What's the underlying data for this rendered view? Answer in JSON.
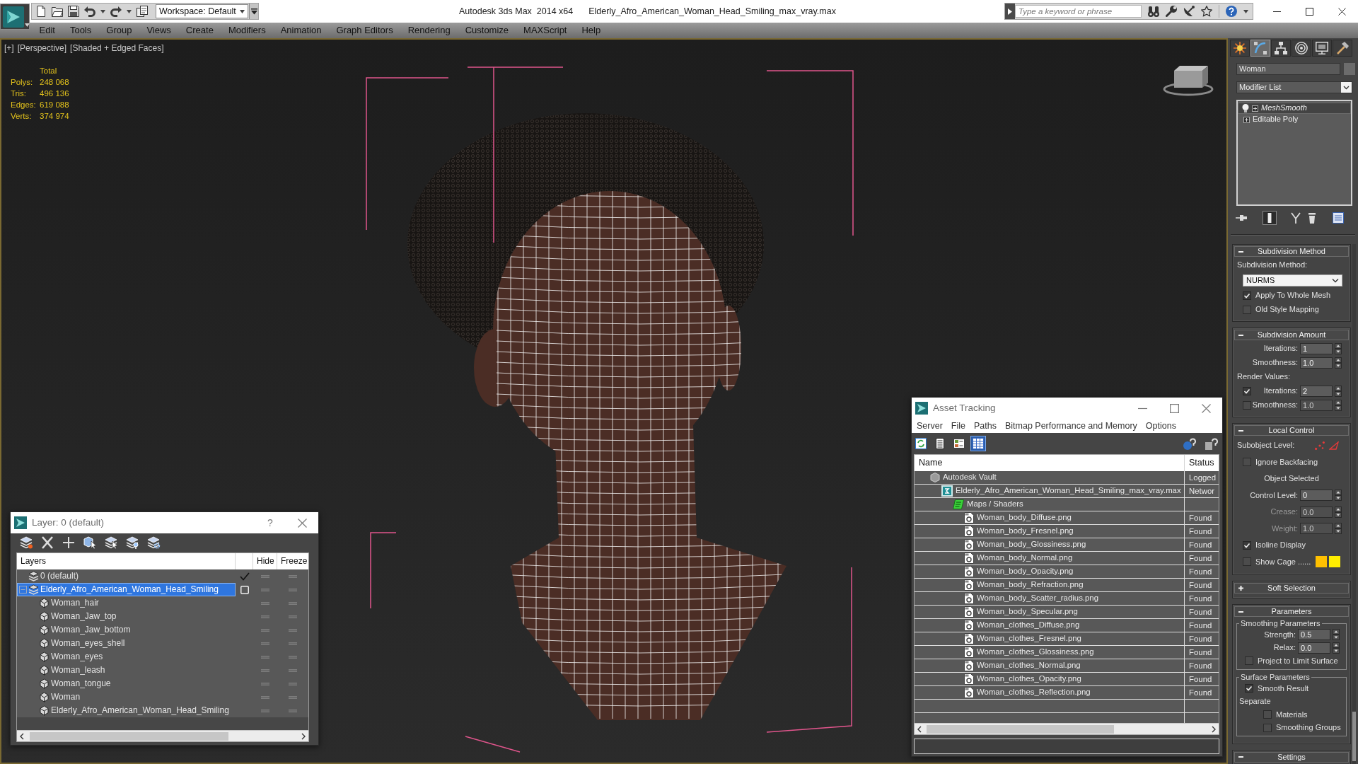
{
  "title_bar": {
    "workspace": "Workspace: Default",
    "app_title": "Autodesk 3ds Max  2014 x64",
    "document": "Elderly_Afro_American_Woman_Head_Smiling_max_vray.max",
    "search": {
      "placeholder": "Type a keyword or phrase"
    }
  },
  "menu_bar": [
    "Edit",
    "Tools",
    "Group",
    "Views",
    "Create",
    "Modifiers",
    "Animation",
    "Graph Editors",
    "Rendering",
    "Customize",
    "MAXScript",
    "Help"
  ],
  "viewport": {
    "labels": [
      "[+]",
      "[Perspective]",
      "[Shaded + Edged Faces]"
    ],
    "stats": {
      "heading": "Total",
      "rows": [
        {
          "label": "Polys:",
          "value": "248 068"
        },
        {
          "label": "Tris:",
          "value": "496 136"
        },
        {
          "label": "Edges:",
          "value": "619 088"
        },
        {
          "label": "Verts:",
          "value": "374 974"
        }
      ]
    }
  },
  "layer_dialog": {
    "title": "Layer: 0 (default)",
    "help_button": "?",
    "columns": [
      "Layers",
      "Hide",
      "Freeze"
    ],
    "layers": [
      {
        "name": "0 (default)",
        "current": true,
        "selected": false,
        "hidden": false,
        "frozen": false
      },
      {
        "name": "Elderly_Afro_American_Woman_Head_Smiling",
        "current": false,
        "selected": true,
        "expanded": true,
        "hidden": false,
        "frozen": false,
        "children": [
          {
            "name": "Woman_hair",
            "selected": false,
            "hidden": false,
            "frozen": false
          },
          {
            "name": "Woman_Jaw_top",
            "selected": false,
            "hidden": false,
            "frozen": false
          },
          {
            "name": "Woman_Jaw_bottom",
            "selected": false,
            "hidden": false,
            "frozen": false
          },
          {
            "name": "Woman_eyes_shell",
            "selected": false,
            "hidden": false,
            "frozen": false
          },
          {
            "name": "Woman_eyes",
            "selected": false,
            "hidden": false,
            "frozen": false
          },
          {
            "name": "Woman_leash",
            "selected": false,
            "hidden": false,
            "frozen": false
          },
          {
            "name": "Woman_tongue",
            "selected": false,
            "hidden": false,
            "frozen": false
          },
          {
            "name": "Woman",
            "selected": false,
            "hidden": false,
            "frozen": false
          },
          {
            "name": "Elderly_Afro_American_Woman_Head_Smiling",
            "selected": false,
            "hidden": false,
            "frozen": false
          }
        ]
      }
    ]
  },
  "asset_dialog": {
    "title": "Asset Tracking",
    "menu": [
      "Server",
      "File",
      "Paths",
      "Bitmap Performance and Memory",
      "Options"
    ],
    "view_buttons": [
      {
        "kind": "refresh",
        "selected": false
      },
      {
        "kind": "list",
        "selected": false
      },
      {
        "kind": "thumbs",
        "selected": false
      },
      {
        "kind": "table",
        "selected": true
      }
    ],
    "columns": [
      "Name",
      "Status"
    ],
    "assets": [
      {
        "kind": "vault",
        "name": "Autodesk Vault",
        "status": "Logged",
        "children": [
          {
            "kind": "scene",
            "name": "Elderly_Afro_American_Woman_Head_Smiling_max_vray.max",
            "status": "Networ",
            "children": [
              {
                "kind": "folder",
                "name": "Maps / Shaders",
                "children": [
                  {
                    "kind": "bitmap",
                    "name": "Woman_body_Diffuse.png",
                    "status": "Found"
                  },
                  {
                    "kind": "bitmap",
                    "name": "Woman_body_Fresnel.png",
                    "status": "Found"
                  },
                  {
                    "kind": "bitmap",
                    "name": "Woman_body_Glossiness.png",
                    "status": "Found"
                  },
                  {
                    "kind": "bitmap",
                    "name": "Woman_body_Normal.png",
                    "status": "Found"
                  },
                  {
                    "kind": "bitmap",
                    "name": "Woman_body_Opacity.png",
                    "status": "Found"
                  },
                  {
                    "kind": "bitmap",
                    "name": "Woman_body_Refraction.png",
                    "status": "Found"
                  },
                  {
                    "kind": "bitmap",
                    "name": "Woman_body_Scatter_radius.png",
                    "status": "Found"
                  },
                  {
                    "kind": "bitmap",
                    "name": "Woman_body_Specular.png",
                    "status": "Found"
                  },
                  {
                    "kind": "bitmap",
                    "name": "Woman_clothes_Diffuse.png",
                    "status": "Found"
                  },
                  {
                    "kind": "bitmap",
                    "name": "Woman_clothes_Fresnel.png",
                    "status": "Found"
                  },
                  {
                    "kind": "bitmap",
                    "name": "Woman_clothes_Glossiness.png",
                    "status": "Found"
                  },
                  {
                    "kind": "bitmap",
                    "name": "Woman_clothes_Normal.png",
                    "status": "Found"
                  },
                  {
                    "kind": "bitmap",
                    "name": "Woman_clothes_Opacity.png",
                    "status": "Found"
                  },
                  {
                    "kind": "bitmap",
                    "name": "Woman_clothes_Reflection.png",
                    "status": "Found"
                  }
                ]
              }
            ]
          }
        ]
      }
    ]
  },
  "command_panel": {
    "tabs": [
      {
        "kind": "create",
        "selected": false
      },
      {
        "kind": "modify",
        "selected": true
      },
      {
        "kind": "hierarchy",
        "selected": false
      },
      {
        "kind": "motion",
        "selected": false
      },
      {
        "kind": "display",
        "selected": false
      },
      {
        "kind": "utilities",
        "selected": false
      }
    ],
    "object_name": "Woman",
    "modifier_list": "Modifier List",
    "stack": [
      {
        "kind": "modifier",
        "label": "MeshSmooth",
        "selected": true,
        "expanded": false
      },
      {
        "kind": "object",
        "label": "Editable Poly",
        "selected": false,
        "expanded": false
      }
    ],
    "stack_tools": [
      {
        "kind": "pin",
        "on": false
      },
      {
        "kind": "endresult",
        "on": true
      },
      {
        "kind": "unique",
        "on": false
      },
      {
        "kind": "remove",
        "on": false
      },
      {
        "kind": "configure",
        "on": false
      }
    ],
    "rollouts": [
      {
        "title": "Subdivision Method",
        "expanded": true,
        "controls": [
          {
            "kind": "label",
            "text": "Subdivision Method:"
          },
          {
            "kind": "dropdown",
            "value": "NURMS"
          },
          {
            "kind": "checkbox",
            "label": "Apply To Whole Mesh",
            "checked": true
          },
          {
            "kind": "checkbox",
            "label": "Old Style Mapping",
            "checked": false
          }
        ]
      },
      {
        "title": "Subdivision Amount",
        "expanded": true,
        "controls": [
          {
            "kind": "spinner",
            "label": "Iterations:",
            "value": "1",
            "disabled": false
          },
          {
            "kind": "spinner",
            "label": "Smoothness:",
            "value": "1.0",
            "disabled": false
          },
          {
            "kind": "label",
            "text": "Render Values:"
          },
          {
            "kind": "checkspinner",
            "label": "Iterations:",
            "value": "2",
            "checked": true
          },
          {
            "kind": "checkspinner",
            "label": "Smoothness:",
            "value": "1.0",
            "checked": false
          }
        ]
      },
      {
        "title": "Local Control",
        "expanded": true,
        "controls": [
          {
            "kind": "subobject",
            "label": "Subobject Level:"
          },
          {
            "kind": "checkbox",
            "label": "Ignore Backfacing",
            "checked": false
          },
          {
            "kind": "caption",
            "text": "Object Selected"
          },
          {
            "kind": "spinner",
            "label": "Control Level:",
            "value": "0",
            "disabled": false
          },
          {
            "kind": "spinner",
            "label": "Crease:",
            "value": "0.0",
            "disabled": true
          },
          {
            "kind": "spinner",
            "label": "Weight:",
            "value": "1.0",
            "disabled": true
          },
          {
            "kind": "checkbox",
            "label": "Isoline Display",
            "checked": true
          },
          {
            "kind": "cage",
            "label": "Show Cage ......",
            "checked": false,
            "swatches": [
              {
                "color": "#ffc000"
              },
              {
                "color": "#ffee00"
              }
            ]
          }
        ]
      },
      {
        "title": "Soft Selection",
        "expanded": false
      },
      {
        "title": "Parameters",
        "expanded": true,
        "controls": [
          {
            "kind": "group",
            "title": "Smoothing Parameters",
            "controls": [
              {
                "kind": "spinner",
                "label": "Strength:",
                "value": "0.5",
                "disabled": false
              },
              {
                "kind": "spinner",
                "label": "Relax:",
                "value": "0.0",
                "disabled": false
              },
              {
                "kind": "checkbox",
                "label": "Project to Limit Surface",
                "checked": false
              }
            ]
          },
          {
            "kind": "group",
            "title": "Surface Parameters",
            "controls": [
              {
                "kind": "checkbox",
                "label": "Smooth Result",
                "checked": true
              },
              {
                "kind": "label",
                "text": "Separate",
                "children": [
                  {
                    "kind": "checkbox",
                    "label": "Materials",
                    "checked": false
                  },
                  {
                    "kind": "checkbox",
                    "label": "Smoothing Groups",
                    "checked": false
                  }
                ]
              }
            ]
          }
        ]
      },
      {
        "title": "Settings",
        "expanded": true
      }
    ]
  }
}
